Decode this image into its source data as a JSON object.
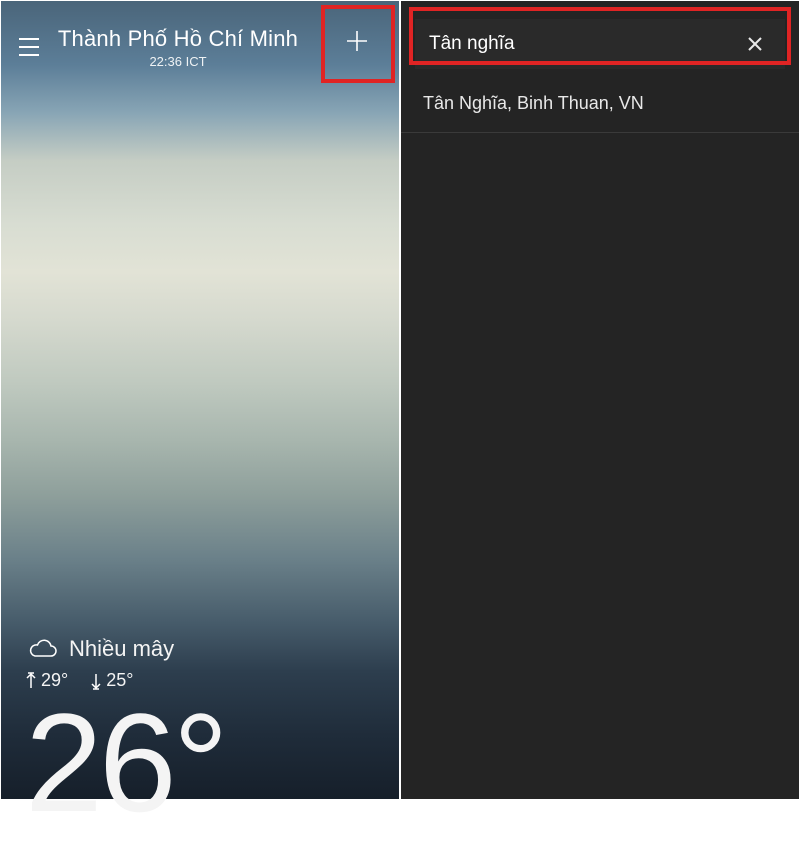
{
  "left": {
    "city_name": "Thành Phố Hồ Chí Minh",
    "time_label": "22:36 ICT",
    "condition": "Nhiều mây",
    "high": "29°",
    "low": "25°",
    "temp": "26°"
  },
  "right": {
    "search_value": "Tân nghĩa",
    "results": [
      "Tân Nghĩa, Binh Thuan, VN"
    ]
  },
  "colors": {
    "highlight": "#e02424",
    "dark_bg": "#242424"
  }
}
